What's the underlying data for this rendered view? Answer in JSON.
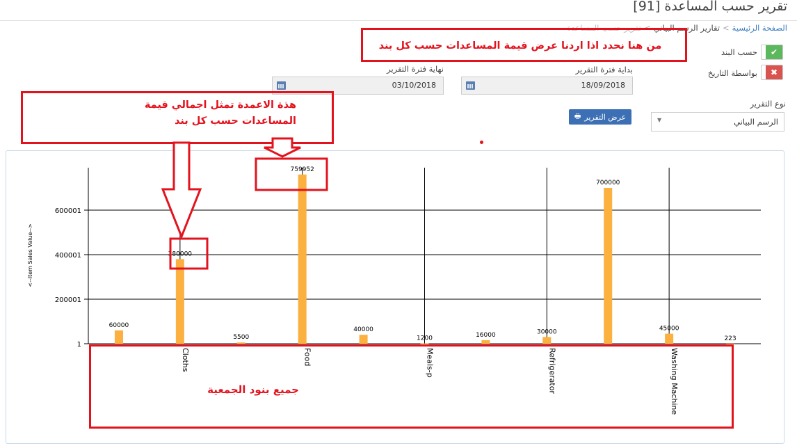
{
  "page": {
    "title": "تقرير حسب المساعدة [91]"
  },
  "breadcrumb": {
    "home": "الصفحة الرئيسية",
    "current": "تقارير الرسم البياني",
    "faded": "تقرير حسب المساعدة"
  },
  "filters": {
    "by_item": {
      "label": "حسب البند",
      "state": "on"
    },
    "by_date": {
      "label": "بواسطة التاريخ",
      "state": "off"
    },
    "start": {
      "label": "بداية فترة التقرير",
      "value": "18/09/2018"
    },
    "end": {
      "label": "نهاية فترة التقرير",
      "value": "03/10/2018"
    },
    "report_type": {
      "label": "نوع التقرير",
      "value": "الرسم البياني"
    },
    "show_button": "عرض التقرير"
  },
  "annotations": {
    "top": "من هنا نحدد اذا اردنا عرض قيمة المساعدات حسب كل بند",
    "bars_line1": "هذة الاعمدة تمثل اجمالي قيمة",
    "bars_line2": "المساعدات حسب كل بند",
    "items": "جميع بنود الجمعية"
  },
  "colors": {
    "bar": "#fbb040",
    "annotation": "#e3131e",
    "on": "#5cb85c",
    "off": "#d9534f",
    "button": "#3c6fb3"
  },
  "chart_data": {
    "type": "bar",
    "categories": [
      "",
      "Cloths",
      "",
      "Food",
      "",
      "Meals-p",
      "",
      "Refrigerator",
      "",
      "Washing Machine",
      ""
    ],
    "values": [
      60000,
      380000,
      5500,
      759952,
      40000,
      1200,
      16000,
      30000,
      700000,
      45000,
      223
    ],
    "data_labels": [
      "60000",
      "380000",
      "5500",
      "759952",
      "40000",
      "1200",
      "16000",
      "30000",
      "700000",
      "45000",
      "223"
    ],
    "yticks": [
      "1",
      "200001",
      "400001",
      "600001"
    ],
    "ylabel": "<--Item Sales Value-->",
    "ylim": [
      0,
      760000
    ],
    "grid": true
  }
}
